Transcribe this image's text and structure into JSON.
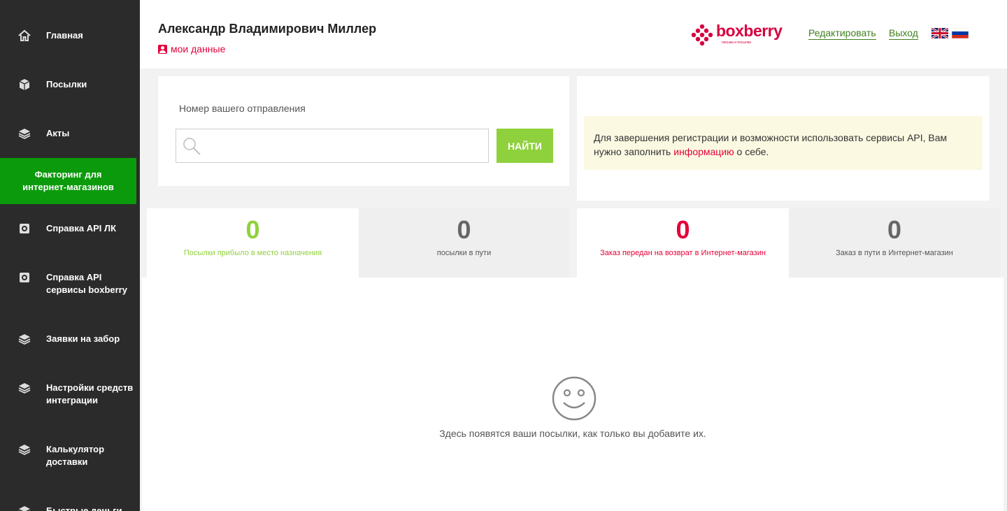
{
  "sidebar": {
    "items": [
      {
        "label": "Главная",
        "icon": "home-icon"
      },
      {
        "label": "Посылки",
        "icon": "package-icon"
      },
      {
        "label": "Акты",
        "icon": "layers-icon"
      },
      {
        "label": "Факторинг для интернет-магазинов",
        "active": true
      },
      {
        "label": "Справка API ЛК",
        "icon": "gear-icon"
      },
      {
        "label": "Справка API сервисы boxberry",
        "icon": "gear-icon"
      },
      {
        "label": "Заявки на забор",
        "icon": "layers-icon"
      },
      {
        "label": "Настройки средств интеграции",
        "icon": "layers-icon"
      },
      {
        "label": "Калькулятор доставки",
        "icon": "layers-icon"
      },
      {
        "label": "Быстрые деньги",
        "icon": "layers-icon"
      }
    ],
    "active_color": "#0b9a0b"
  },
  "header": {
    "user_name": "Александр Владимирович Миллер",
    "my_data": "мои данные",
    "logo_text": "boxberry",
    "logo_sub": "письма и посылки",
    "edit_link": "Редактировать",
    "logout_link": "Выход",
    "languages": [
      "english-flag-icon",
      "russian-flag-icon"
    ]
  },
  "search": {
    "label": "Номер вашего отправления",
    "value": "",
    "button": "НАЙТИ"
  },
  "notice": {
    "text_before": "Для завершения регистрации и возможности использовать сервисы API, Вам нужно заполнить ",
    "link": "информацию",
    "text_after": " о себе."
  },
  "stats": [
    {
      "value": "0",
      "caption": "Посылки прибыло в место назначения",
      "color": "#8fd13c"
    },
    {
      "value": "0",
      "caption": "посылки в пути",
      "color": "#666666"
    },
    {
      "value": "0",
      "caption": "Заказ передан на возврат в Интернет-магазин",
      "color": "#e4003a"
    },
    {
      "value": "0",
      "caption": "Заказ в пути в Интернет-магазин",
      "color": "#666666"
    }
  ],
  "empty_state": {
    "icon": "smiley-icon",
    "text": "Здесь появятся ваши посылки, как только вы добавите их."
  },
  "colors": {
    "brand": "#d7003f",
    "accent_green": "#8fd13c",
    "link_green": "#3f7f1e",
    "sidebar_bg": "#2b2b2b"
  }
}
